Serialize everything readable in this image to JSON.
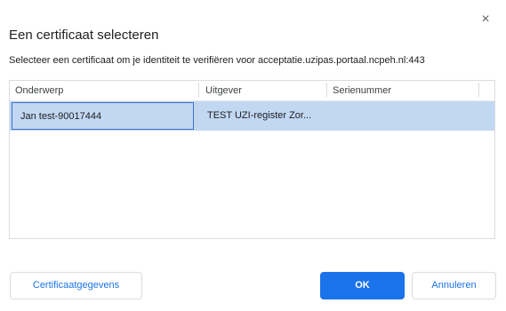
{
  "dialog": {
    "close_glyph": "×",
    "title": "Een certificaat selecteren",
    "subtitle": "Selecteer een certificaat om je identiteit te verifiëren voor acceptatie.uzipas.portaal.ncpeh.nl:443"
  },
  "table": {
    "columns": [
      "Onderwerp",
      "Uitgever",
      "Serienummer"
    ],
    "rows": [
      {
        "subject": "Jan test-90017444",
        "issuer": "TEST UZI-register Zor...",
        "serial": "",
        "selected": true
      }
    ]
  },
  "buttons": {
    "details": "Certificaatgegevens",
    "ok": "OK",
    "cancel": "Annuleren"
  },
  "colors": {
    "accent": "#1a73e8",
    "selection": "#c2d7f2"
  }
}
